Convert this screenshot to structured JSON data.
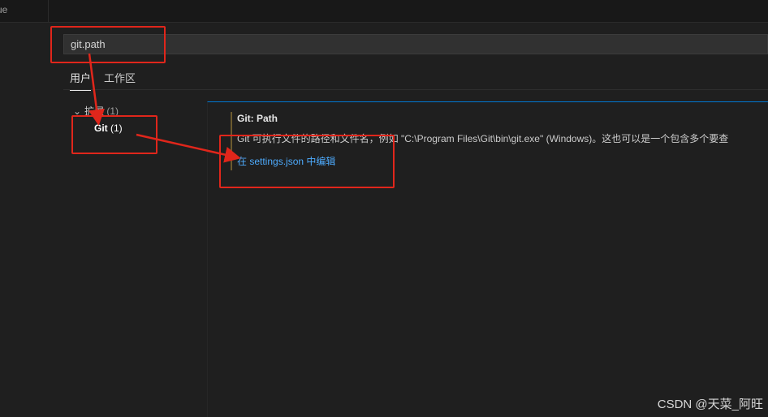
{
  "tab": {
    "label": "ue"
  },
  "search": {
    "value": "git.path"
  },
  "scopes": [
    {
      "label": "用户",
      "active": true
    },
    {
      "label": "工作区",
      "active": false
    }
  ],
  "toc": {
    "group_label": "扩展",
    "group_count": "(1)",
    "item_label": "Git",
    "item_count": "(1)"
  },
  "setting": {
    "title": "Git: Path",
    "description": "Git 可执行文件的路径和文件名，例如 \"C:\\Program Files\\Git\\bin\\git.exe\" (Windows)。这也可以是一个包含多个要查",
    "link": "在 settings.json 中编辑"
  },
  "watermark": "CSDN @天菜_阿旺",
  "colors": {
    "accent": "#0078d4",
    "annotation": "#e0261b",
    "link": "#4daafc"
  }
}
